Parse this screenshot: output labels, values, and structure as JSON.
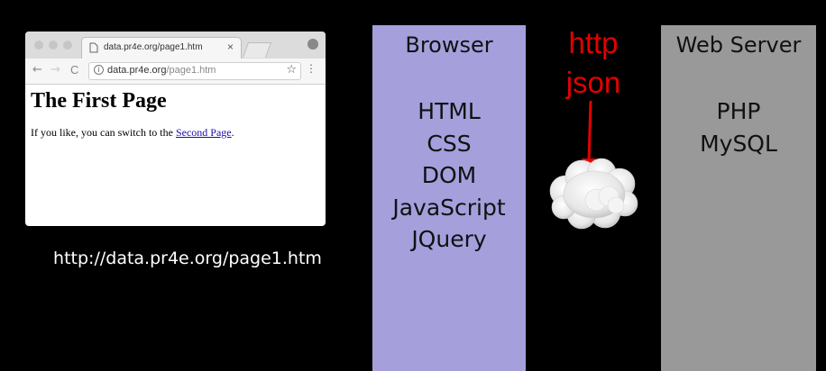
{
  "browser_window": {
    "tab_title": "data.pr4e.org/page1.htm",
    "tab_close": "×",
    "nav_back": "←",
    "nav_forward": "→",
    "nav_reload": "C",
    "url_host": "data.pr4e.org",
    "url_path": "/page1.htm",
    "star": "☆",
    "menu": "⋮",
    "page_heading": "The First Page",
    "page_text": "If you like, you can switch to the",
    "page_link": "Second Page",
    "page_text_end": "."
  },
  "caption": "http://data.pr4e.org/page1.htm",
  "browser_column": {
    "title": "Browser",
    "items": [
      "HTML",
      "CSS",
      "DOM",
      "JavaScript",
      "JQuery"
    ],
    "color": "#a59fdc"
  },
  "protocol": {
    "line1": "http",
    "line2": "json",
    "color": "#e50000"
  },
  "server_column": {
    "title": "Web Server",
    "items": [
      "PHP",
      "MySQL"
    ],
    "color": "#999999"
  }
}
